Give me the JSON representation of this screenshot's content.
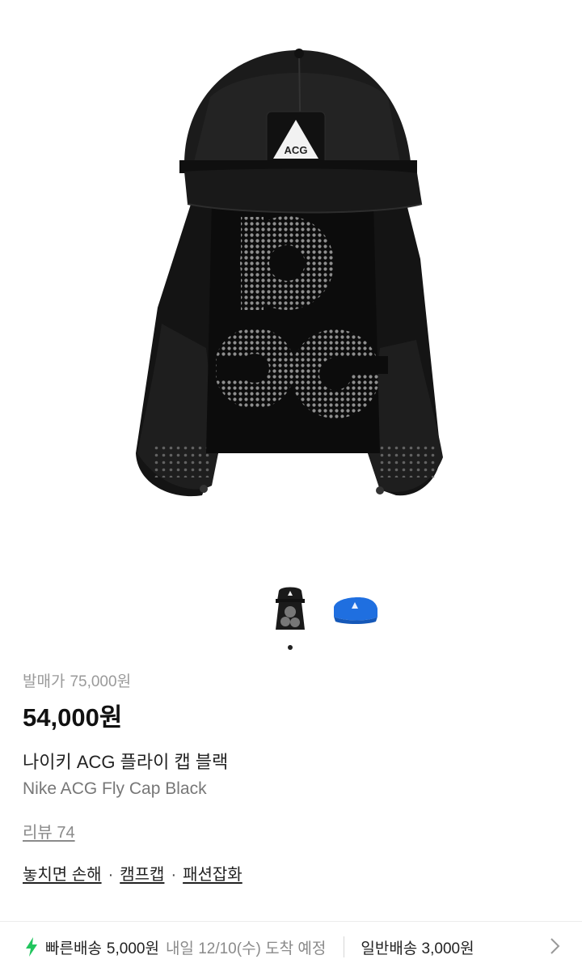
{
  "product": {
    "release_label": "발매가",
    "release_price": "75,000원",
    "price": "54,000원",
    "name_ko": "나이키 ACG 플라이 캡 블랙",
    "name_en": "Nike ACG Fly Cap Black",
    "review_label": "리뷰 74",
    "tags": [
      "놓치면 손해",
      "캠프캡",
      "패션잡화"
    ],
    "tag_separator": "·",
    "logo_text": "ACG"
  },
  "gallery": {
    "current_index": 1,
    "count": 2,
    "thumbnails": [
      {
        "color": "#1a1a1a"
      },
      {
        "color": "#1f6fe0"
      }
    ]
  },
  "shipping": {
    "fast_label": "빠른배송",
    "fast_price": "5,000원",
    "fast_eta": "내일 12/10(수) 도착 예정",
    "normal_label": "일반배송 3,000원",
    "accent_color": "#22c55e"
  }
}
